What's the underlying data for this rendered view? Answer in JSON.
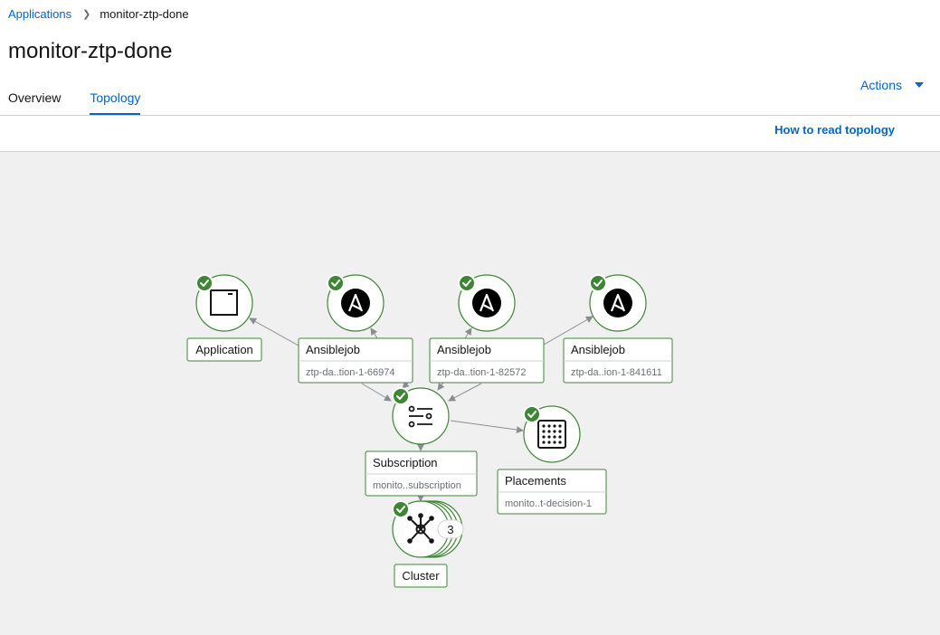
{
  "breadcrumb": {
    "parent": "Applications",
    "current": "monitor-ztp-done"
  },
  "page": {
    "title": "monitor-ztp-done"
  },
  "tabs": [
    {
      "label": "Overview"
    },
    {
      "label": "Topology"
    }
  ],
  "actions": {
    "label": "Actions"
  },
  "topology": {
    "help_link": "How to read topology",
    "nodes": {
      "application": {
        "label": "Application",
        "status": "ok"
      },
      "ansiblejob1": {
        "label": "Ansiblejob",
        "sublabel": "ztp-da..tion-1-66974",
        "status": "ok"
      },
      "ansiblejob2": {
        "label": "Ansiblejob",
        "sublabel": "ztp-da..tion-1-82572",
        "status": "ok"
      },
      "ansiblejob3": {
        "label": "Ansiblejob",
        "sublabel": "ztp-da..ion-1-841611",
        "status": "ok"
      },
      "subscription": {
        "label": "Subscription",
        "sublabel": "monito..subscription",
        "status": "ok"
      },
      "placements": {
        "label": "Placements",
        "sublabel": "monito..t-decision-1",
        "status": "ok"
      },
      "cluster": {
        "label": "Cluster",
        "count": "3",
        "status": "ok"
      }
    }
  },
  "colors": {
    "link": "#0066cc",
    "status_ok": "#3e8635",
    "node_border": "#3e8635",
    "canvas": "#f0f0f0"
  }
}
